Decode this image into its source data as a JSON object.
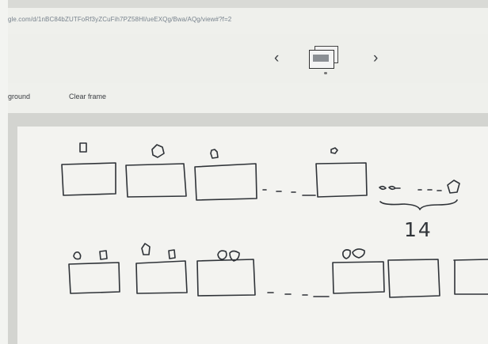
{
  "browser": {
    "url": "gle.com/d/1nBC84bZUTFoRf3yZCuFih7PZ58Hl/ueEXQg/Bwa/AQg/view#?f=2"
  },
  "viewer": {
    "prev_icon": "chevron-left-icon",
    "next_icon": "chevron-right-icon",
    "frame_icon": "frames-icon"
  },
  "toolbar": {
    "background_label": "ground",
    "clear_frame_label": "Clear frame"
  },
  "drawing": {
    "handwritten_number": "14"
  }
}
